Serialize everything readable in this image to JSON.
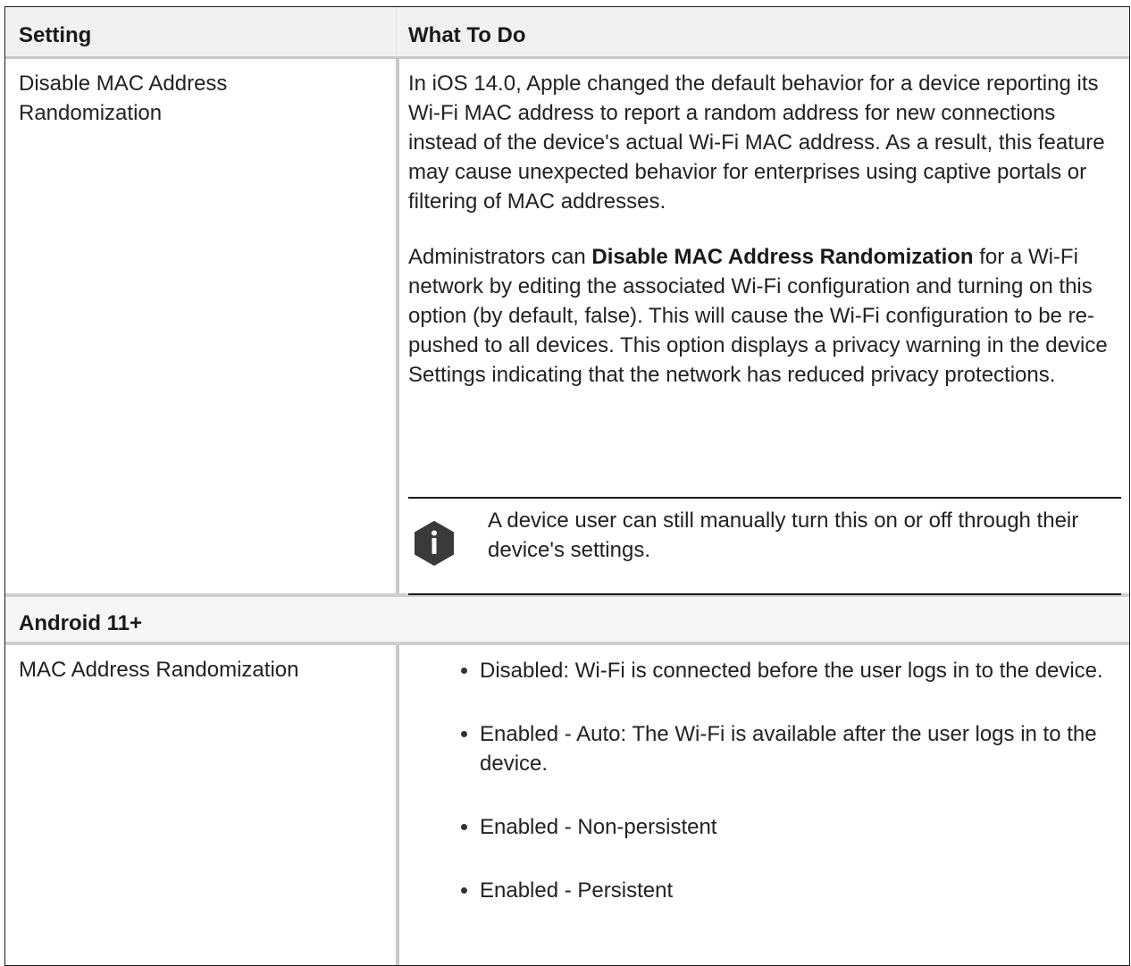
{
  "table": {
    "headers": [
      "Setting",
      "What To Do"
    ],
    "row1": {
      "setting": "Disable MAC Address Randomization",
      "para1": "In iOS 14.0, Apple changed the default behavior for a device reporting its Wi-Fi MAC address to report a random address for new connections instead of the device's actual Wi-Fi MAC address. As a result, this feature may cause unexpected behavior for enterprises using captive portals or filtering of MAC addresses.",
      "para2_prefix": "Administrators can ",
      "para2_bold": "Disable MAC Address Randomization",
      "para2_suffix": " for a Wi-Fi network by editing the associated Wi-Fi configuration and turning on this option (by default, false). This will cause the Wi-Fi configuration to be re-pushed to all devices. This option displays a privacy warning in the device Settings indicating that the network has reduced privacy protections.",
      "note_icon": "info-icon",
      "note_text": "A device user can still manually turn this on or off through their device's settings."
    },
    "section": "Android 11+",
    "row2": {
      "setting": "MAC Address Randomization",
      "bullets": [
        "Disabled: Wi-Fi is connected before the user logs in to the device.",
        "Enabled - Auto: The Wi-Fi is available after the user logs in to the device.",
        "Enabled - Non-persistent",
        "Enabled - Persistent"
      ]
    }
  }
}
